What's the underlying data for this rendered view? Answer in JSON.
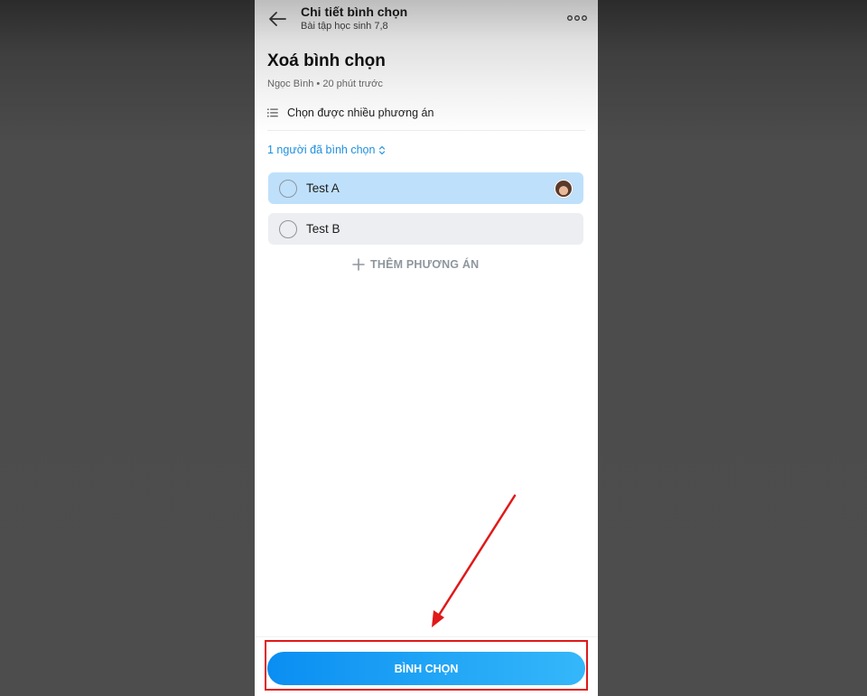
{
  "appbar": {
    "title": "Chi tiết bình chọn",
    "subtitle": "Bài tập học sinh 7,8",
    "back_icon": "arrow-left-icon",
    "more_icon": "more-horizontal-icon"
  },
  "poll": {
    "title": "Xoá bình chọn",
    "meta": "Ngọc Bình • 20 phút trước",
    "rule": "Chọn được nhiều phương án",
    "rule_icon": "list-icon",
    "voters": "1 người đã bình chọn",
    "options": [
      {
        "label": "Test A",
        "selected_color": "#bfe0fb",
        "has_voter_avatar": true
      },
      {
        "label": "Test B",
        "selected_color": "#eceef1",
        "has_voter_avatar": false
      }
    ],
    "add_option": "THÊM PHƯƠNG ÁN"
  },
  "footer": {
    "vote_button": "BÌNH CHỌN"
  },
  "colors": {
    "accent": "#1e8fde",
    "annotation": "#e01919"
  }
}
